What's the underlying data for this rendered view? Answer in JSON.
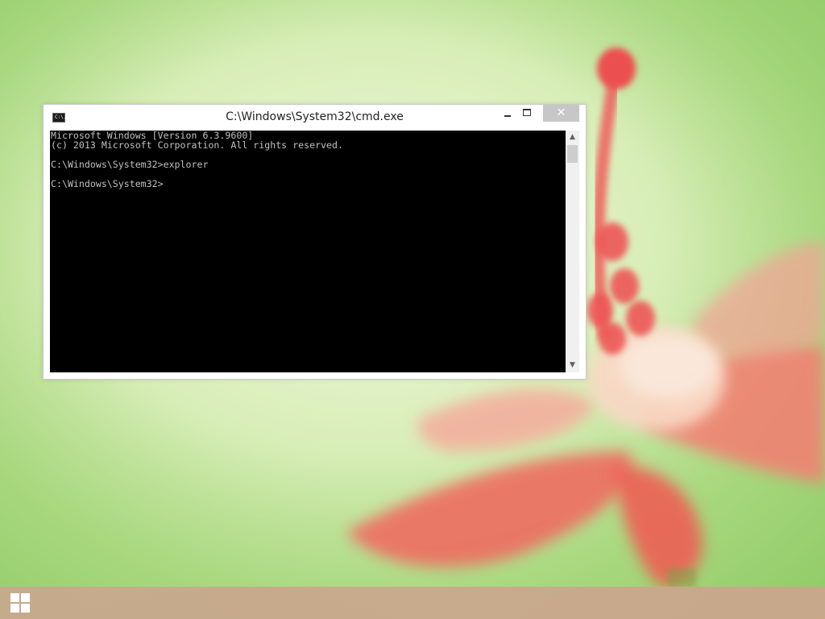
{
  "window": {
    "title": "C:\\Windows\\System32\\cmd.exe",
    "icon_text": "C:\\.",
    "close_symbol": "✕",
    "scroll_up_symbol": "▲",
    "scroll_down_symbol": "▼"
  },
  "console": {
    "lines": [
      "Microsoft Windows [Version 6.3.9600]",
      "(c) 2013 Microsoft Corporation. All rights reserved.",
      "",
      "C:\\Windows\\System32>explorer",
      "",
      "C:\\Windows\\System32>"
    ],
    "text_color": "#c0c0c0",
    "background_color": "#000000"
  },
  "taskbar": {
    "start_icon": "windows-logo-icon"
  },
  "colors": {
    "close_button": "#c7c7c7",
    "taskbar": "#c9a78d"
  }
}
